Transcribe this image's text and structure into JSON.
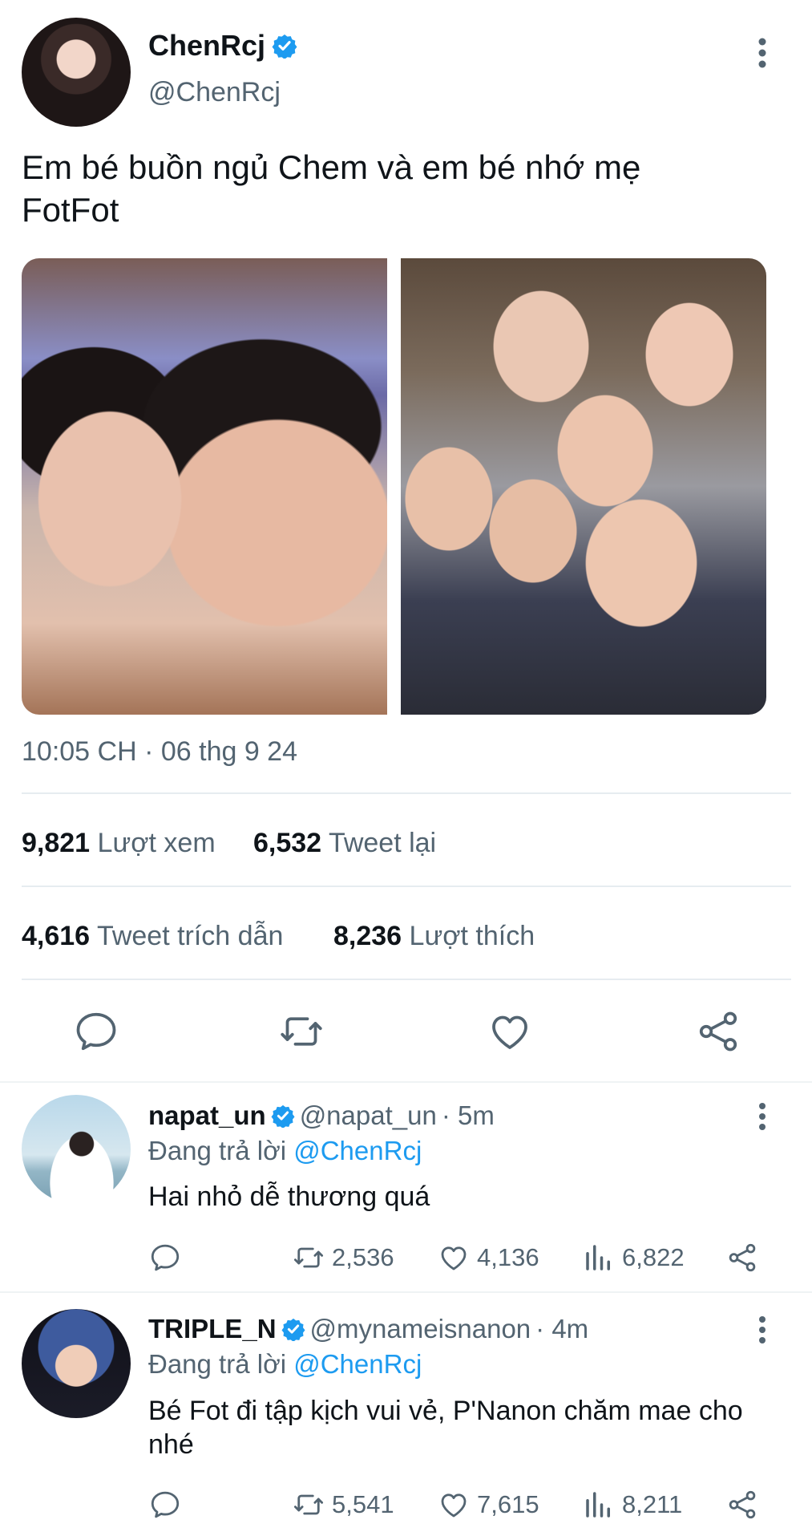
{
  "tweet": {
    "author_name": "ChenRcj",
    "author_handle": "@ChenRcj",
    "text": "Em bé buồn ngủ Chem và em bé nhớ mẹ FotFot",
    "timestamp": "10:05 CH · 06 thg 9 24",
    "stats": {
      "views_count": "9,821",
      "views_label": "Lượt xem",
      "retweets_count": "6,532",
      "retweets_label": "Tweet lại",
      "quotes_count": "4,616",
      "quotes_label": "Tweet trích dẫn",
      "likes_count": "8,236",
      "likes_label": "Lượt thích"
    },
    "actions": [
      "reply-icon",
      "retweet-icon",
      "like-icon",
      "share-icon"
    ]
  },
  "replies": [
    {
      "name": "napat_un",
      "handle": "@napat_un",
      "time": "· 5m",
      "replying_prefix": "Đang trả lời",
      "replying_to": "@ChenRcj",
      "text": "Hai nhỏ dễ thương quá",
      "retweets": "2,536",
      "likes": "4,136",
      "views": "6,822"
    },
    {
      "name": "TRIPLE_N",
      "handle": "@mynameisnanon",
      "time": "· 4m",
      "replying_prefix": "Đang trả lời",
      "replying_to": "@ChenRcj",
      "text": "Bé Fot đi tập kịch vui vẻ, P'Nanon chăm mae cho nhé",
      "retweets": "5,541",
      "likes": "7,615",
      "views": "8,211"
    }
  ],
  "colors": {
    "accent": "#1d9bf0",
    "muted": "#536471",
    "text": "#0f1419",
    "divider": "#e6ecf0"
  }
}
